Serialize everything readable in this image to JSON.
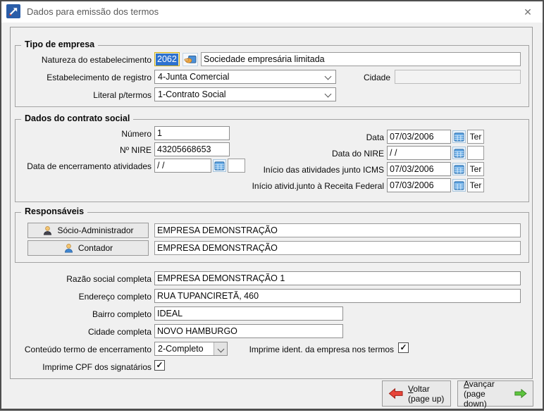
{
  "window": {
    "title": "Dados para emissão dos termos",
    "close_glyph": "✕"
  },
  "icons": {
    "app": "blue-square-diagonal-arrow",
    "lookup": "pointing-hand-card",
    "calendar": "calendar-grid",
    "socio": "person-dark-suit",
    "contador": "person-blue-suit",
    "voltar": "arrow-left-red",
    "avancar": "arrow-right-green",
    "close": "✕"
  },
  "colors": {
    "dialog_bg": "#f0f0f0",
    "selection_blue": "#2d72cf",
    "field_yellow_bg": "#fdf3c0",
    "field_yellow_border": "#d2b019",
    "calendar_blue": "#5aa2e2",
    "arrow_red": "#e8453a",
    "arrow_green": "#5ec43f"
  },
  "tipo_empresa": {
    "title": "Tipo de empresa",
    "natureza_label": "Natureza do estabelecimento",
    "natureza_code": "2062",
    "natureza_desc": "Sociedade empresária limitada",
    "registro_label": "Estabelecimento de registro",
    "registro_value": "4-Junta Comercial",
    "cidade_label": "Cidade",
    "cidade_value": "",
    "literal_label": "Literal p/termos",
    "literal_value": "1-Contrato Social"
  },
  "contrato": {
    "title": "Dados do contrato social",
    "numero_label": "Número",
    "numero_value": "1",
    "nire_label": "Nº NIRE",
    "nire_value": "43205668653",
    "encerramento_label": "Data de encerramento atividades",
    "encerramento_value": "/ /",
    "encerramento_dow": "",
    "data_label": "Data",
    "data_value": "07/03/2006",
    "data_dow": "Ter",
    "data_nire_label": "Data do NIRE",
    "data_nire_value": "/ /",
    "data_nire_dow": "",
    "icms_label": "Início das atividades junto ICMS",
    "icms_value": "07/03/2006",
    "icms_dow": "Ter",
    "receita_label": "Início atividade.junto à Receita Federal",
    "receita_label_shown": "Início ativid.junto à Receita Federal",
    "receita_value": "07/03/2006",
    "receita_dow": "Ter"
  },
  "responsaveis": {
    "title": "Responsáveis",
    "socio_button": "Sócio-Administrador",
    "socio_value": "EMPRESA DEMONSTRAÇÃO",
    "contador_button": "Contador",
    "contador_value": "EMPRESA DEMONSTRAÇÃO"
  },
  "empresa": {
    "razao_label": "Razão social completa",
    "razao_value": "EMPRESA DEMONSTRAÇÃO 1",
    "endereco_label": "Endereço completo",
    "endereco_value": "RUA TUPANCIRETÃ, 460",
    "bairro_label": "Bairro completo",
    "bairro_value": "IDEAL",
    "cidade_label": "Cidade completa",
    "cidade_value": "NOVO HAMBURGO",
    "conteudo_label": "Conteúdo termo de encerramento",
    "conteudo_value": "2-Completo",
    "imprime_ident_label": "Imprime ident. da empresa nos termos",
    "imprime_ident_checked": true,
    "imprime_cpf_label": "Imprime CPF dos signatários",
    "imprime_cpf_checked": true
  },
  "footer": {
    "voltar_initial": "V",
    "voltar_rest": "oltar",
    "voltar_sub": "(page up)",
    "avancar_initial": "A",
    "avancar_rest": "vançar",
    "avancar_sub": "(page down)"
  }
}
